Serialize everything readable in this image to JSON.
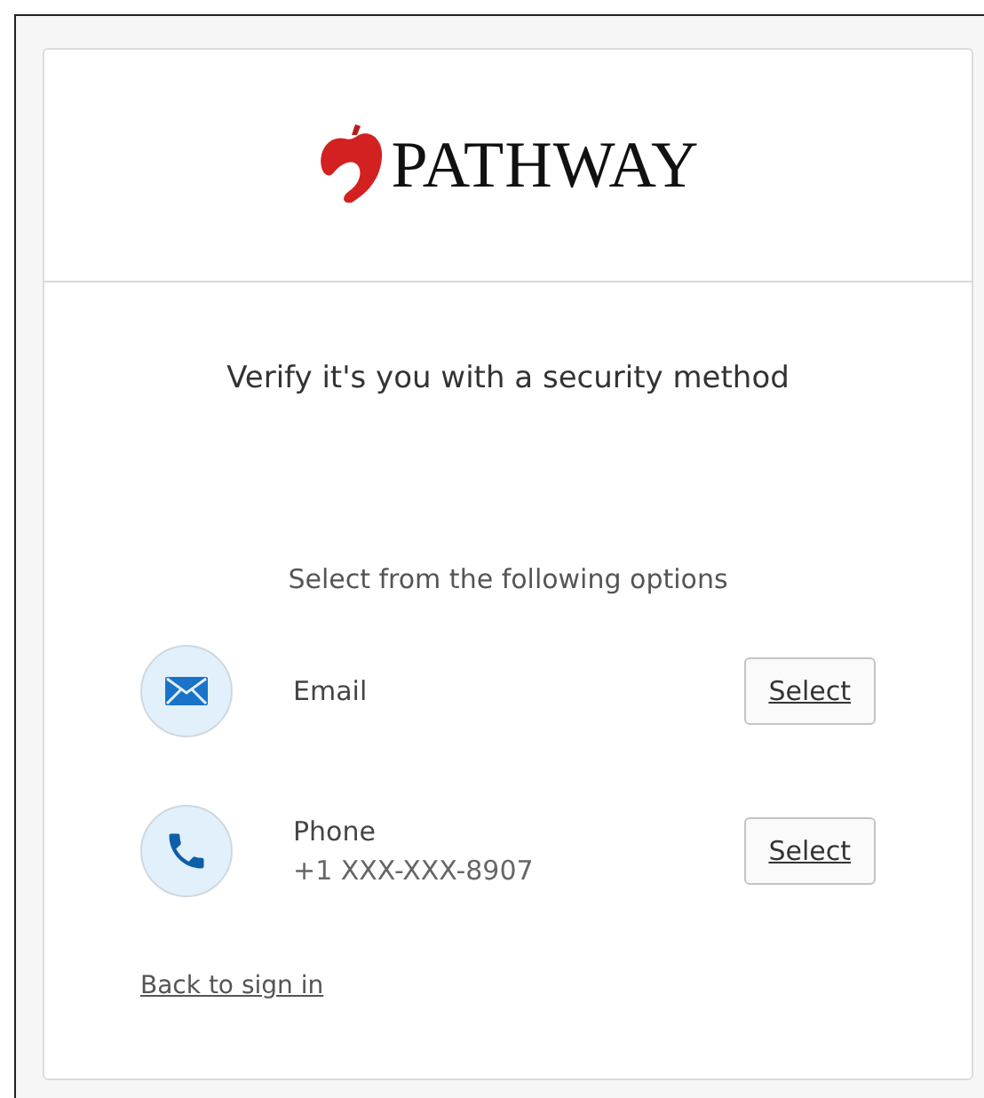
{
  "logo": {
    "text": "PATHWAY"
  },
  "heading": "Verify it's you with a security method",
  "subheading": "Select from the following options",
  "methods": [
    {
      "kind": "email",
      "label": "Email",
      "button": "Select"
    },
    {
      "kind": "phone",
      "label": "Phone",
      "detail": "+1 XXX-XXX-8907",
      "button": "Select"
    }
  ],
  "back_link": "Back to sign in"
}
